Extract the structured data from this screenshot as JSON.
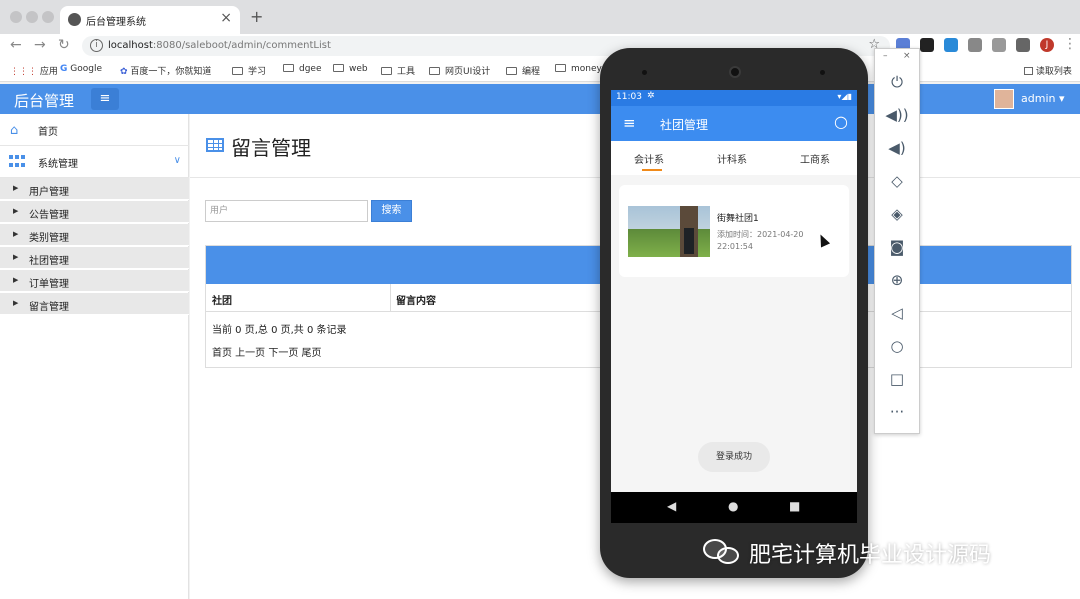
{
  "browser": {
    "tab_title": "后台管理系统",
    "tab_close": "×",
    "new_tab": "+",
    "url_host": "localhost",
    "url_rest": ":8080/saleboot/admin/commentList",
    "bookmarks": [
      "应用",
      "Google",
      "百度一下，你就知道",
      "学习",
      "dgee",
      "web",
      "工具",
      "网页UI设计",
      "编程",
      "money"
    ],
    "reading_list": "读取列表",
    "profile_letter": "J"
  },
  "app": {
    "title": "后台管理",
    "menu_icon": "≡",
    "user": "admin ▾"
  },
  "sidebar": {
    "home": "首页",
    "system": "系统管理",
    "items": [
      "用户管理",
      "公告管理",
      "类别管理",
      "社团管理",
      "订单管理",
      "留言管理"
    ]
  },
  "main": {
    "page_title": "留言管理",
    "search_placeholder": "用户",
    "search_button": "搜索",
    "columns": [
      "社团",
      "留言内容"
    ],
    "pager_info": "当前 0 页,总 0 页,共 0 条记录",
    "pager_nav": "首页 上一页 下一页 尾页"
  },
  "phone": {
    "clock": "11:03",
    "app_title": "社团管理",
    "tabs": [
      "会计系",
      "计科系",
      "工商系"
    ],
    "card": {
      "name": "街舞社团1",
      "time": "添加时间：2021-04-20 22:01:54"
    },
    "toast": "登录成功"
  },
  "watermark": "肥宅计算机毕业设计源码",
  "colors": {
    "primary": "#4a90e8",
    "phone_bar": "#3c8cf0",
    "tab_indicator": "#f08a1a"
  }
}
